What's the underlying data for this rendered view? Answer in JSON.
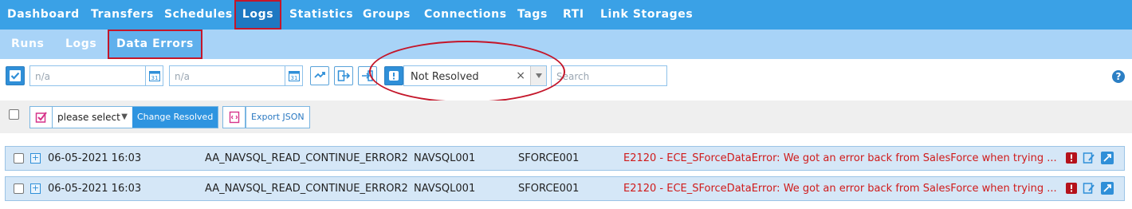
{
  "top_nav": {
    "items": [
      {
        "label": "Dashboard"
      },
      {
        "label": "Transfers"
      },
      {
        "label": "Schedules"
      },
      {
        "label": "Logs"
      },
      {
        "label": "Statistics"
      },
      {
        "label": "Groups"
      },
      {
        "label": "Connections"
      },
      {
        "label": "Tags"
      },
      {
        "label": "RTI"
      },
      {
        "label": "Link Storages"
      }
    ],
    "active": "Logs"
  },
  "sub_nav": {
    "items": [
      {
        "label": "Runs"
      },
      {
        "label": "Logs"
      },
      {
        "label": "Data Errors"
      }
    ],
    "active": "Data Errors"
  },
  "filters": {
    "date_from_placeholder": "n/a",
    "date_to_placeholder": "n/a",
    "calendar_day": "31",
    "status_value": "Not Resolved",
    "search_placeholder": "Search",
    "help_glyph": "?"
  },
  "actions": {
    "select_placeholder": "please select",
    "change_resolved_label": "Change Resolved",
    "export_json_label": "Export JSON"
  },
  "rows": [
    {
      "date": "06-05-2021 16:03",
      "transfer": "AA_NAVSQL_READ_CONTINUE_ERROR2",
      "source": "NAVSQL001",
      "target": "SFORCE001",
      "error": "E2120 - ECE_SForceDataError: We got an error back from SalesForce when trying ..."
    },
    {
      "date": "06-05-2021 16:03",
      "transfer": "AA_NAVSQL_READ_CONTINUE_ERROR2",
      "source": "NAVSQL001",
      "target": "SFORCE001",
      "error": "E2120 - ECE_SForceDataError: We got an error back from SalesForce when trying ..."
    }
  ],
  "colors": {
    "nav_bg": "#3aa1e6",
    "nav_active": "#1e78c2",
    "subnav_bg": "#a8d3f7",
    "highlight_red": "#c4162a",
    "error_text": "#d01b1b",
    "row_bg": "#d5e7f7"
  },
  "icons": [
    "checkbox-icon",
    "calendar-icon",
    "refresh-icon",
    "export-icon",
    "import-icon",
    "info-icon",
    "help-icon",
    "alert-icon",
    "edit-icon",
    "open-icon"
  ]
}
